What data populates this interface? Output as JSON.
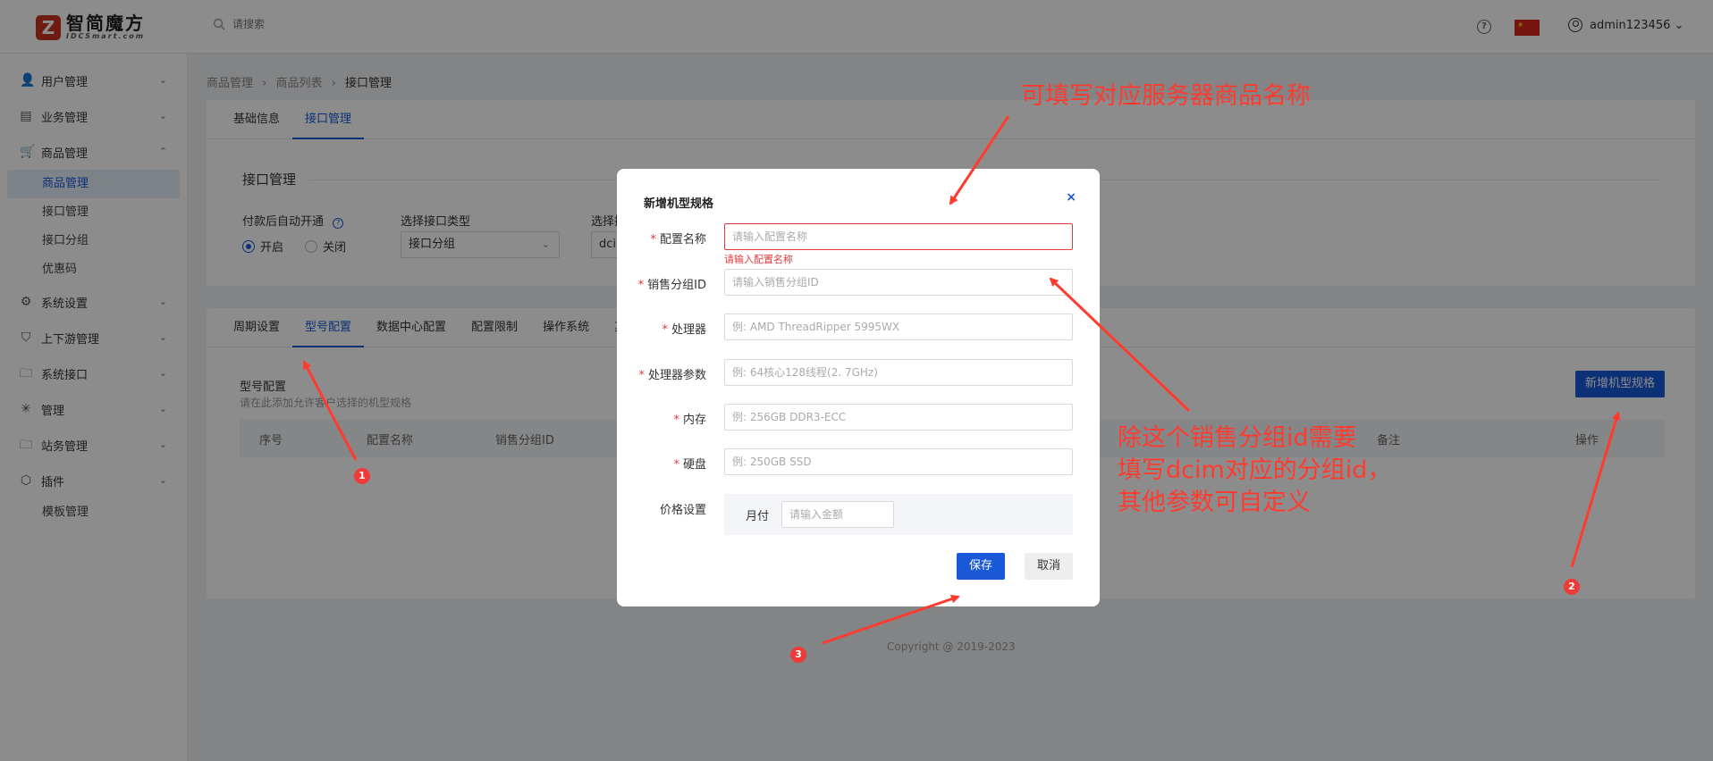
{
  "logo": {
    "mark": "Z",
    "name": "智简魔方",
    "sub": "IDCSmart.com"
  },
  "topbar": {
    "search_placeholder": "请搜索",
    "help": "?",
    "username": "admin123456 ⌄"
  },
  "sidebar": {
    "items": [
      {
        "label": "用户管理",
        "icon": "user-icon",
        "glyph": "👤",
        "chev": "⌄"
      },
      {
        "label": "业务管理",
        "icon": "list-icon",
        "glyph": "▤",
        "chev": "⌄"
      },
      {
        "label": "商品管理",
        "icon": "cart-icon",
        "glyph": "🛒",
        "chev": "⌃"
      },
      {
        "label": "系统设置",
        "icon": "gear-icon",
        "glyph": "⚙",
        "chev": "⌄"
      },
      {
        "label": "上下游管理",
        "icon": "filter-icon",
        "glyph": "⛉",
        "chev": "⌄"
      },
      {
        "label": "系统接口",
        "icon": "folder-icon",
        "glyph": "🗀",
        "chev": "⌄"
      },
      {
        "label": "管理",
        "icon": "asterisk-icon",
        "glyph": "✳",
        "chev": "⌄"
      },
      {
        "label": "站务管理",
        "icon": "folder-icon",
        "glyph": "🗀",
        "chev": "⌄"
      },
      {
        "label": "插件",
        "icon": "box-icon",
        "glyph": "⬡",
        "chev": "⌄"
      }
    ],
    "sub_items": [
      "商品管理",
      "接口管理",
      "接口分组",
      "优惠码"
    ],
    "extra_item": "模板管理"
  },
  "breadcrumb": [
    "商品管理",
    "商品列表",
    "接口管理"
  ],
  "breadcrumb_sep": "›",
  "top_tabs": [
    "基础信息",
    "接口管理"
  ],
  "interface": {
    "title": "接口管理",
    "auto_open_label": "付款后自动开通",
    "radio_on": "开启",
    "radio_off": "关闭",
    "type_label": "选择接口类型",
    "type_value": "接口分组",
    "iface_label": "选择接",
    "iface_value": "dcim",
    "arrow": "⌄"
  },
  "bottom_tabs": [
    "周期设置",
    "型号配置",
    "数据中心配置",
    "配置限制",
    "操作系统",
    "其他"
  ],
  "model_config": {
    "title": "型号配置",
    "desc": "请在此添加允许客户选择的机型规格",
    "add_button": "新增机型规格",
    "columns": [
      "序号",
      "配置名称",
      "销售分组ID",
      "备注",
      "操作"
    ]
  },
  "copyright": "Copyright @ 2019-2023",
  "modal": {
    "title": "新增机型规格",
    "close": "×",
    "required_mark": "*",
    "fields": [
      {
        "label": "配置名称",
        "required": true,
        "placeholder": "请输入配置名称"
      },
      {
        "label": "销售分组ID",
        "required": true,
        "placeholder": "请输入销售分组ID"
      },
      {
        "label": "处理器",
        "required": true,
        "placeholder": "例: AMD ThreadRipper 5995WX"
      },
      {
        "label": "处理器参数",
        "required": true,
        "placeholder": "例: 64核心128线程(2. 7GHz)"
      },
      {
        "label": "内存",
        "required": true,
        "placeholder": "例: 256GB DDR3-ECC"
      },
      {
        "label": "硬盘",
        "required": true,
        "placeholder": "例: 250GB SSD"
      }
    ],
    "error_text": "请输入配置名称",
    "price_label": "价格设置",
    "price_period": "月付",
    "price_placeholder": "请输入金额",
    "save": "保存",
    "cancel": "取消"
  },
  "annotations": {
    "top_note": "可填写对应服务器商品名称",
    "side_note_lines": [
      "除这个销售分组id需要",
      "填写dcim对应的分组id，",
      "其他参数可自定义"
    ],
    "badges": [
      "1",
      "2",
      "3"
    ],
    "color": "#ff3b30"
  },
  "colors": {
    "primary": "#1959d8",
    "error": "#e23b3b",
    "overlay": "rgba(0,0,0,0.45)"
  }
}
